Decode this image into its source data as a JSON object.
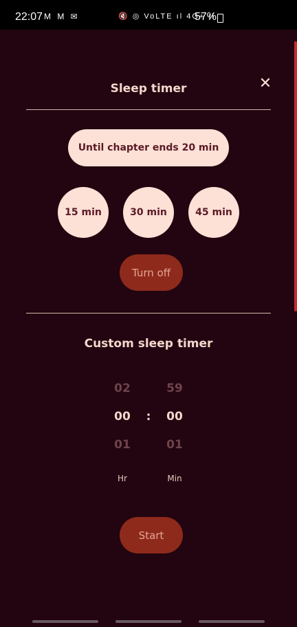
{
  "status": {
    "time": "22:07",
    "left_icons": "M M ✉",
    "right_icons": "🔇 ◎ VoLTE ıl 4G+ ıl",
    "battery": "57%"
  },
  "dialog": {
    "title": "Sleep timer",
    "close_icon": "✕",
    "chapter_option": "Until chapter ends 20 min",
    "presets": [
      "15 min",
      "30 min",
      "45 min"
    ],
    "turn_off_label": "Turn off"
  },
  "custom": {
    "title": "Custom sleep timer",
    "hours": {
      "prev": "02",
      "current": "00",
      "next": "01",
      "unit": "Hr"
    },
    "minutes": {
      "prev": "59",
      "current": "00",
      "next": "01",
      "unit": "Min"
    },
    "separator": ":",
    "start_label": "Start"
  }
}
